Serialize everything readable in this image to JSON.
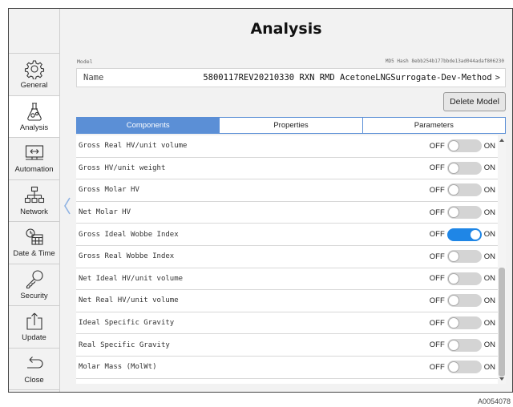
{
  "title": "Analysis",
  "sidebar": {
    "items": [
      {
        "label": "General",
        "icon": "gear-icon"
      },
      {
        "label": "Analysis",
        "icon": "flask-gears-icon",
        "active": true
      },
      {
        "label": "Automation",
        "icon": "monitor-arrows-icon"
      },
      {
        "label": "Network",
        "icon": "network-icon"
      },
      {
        "label": "Date & Time",
        "icon": "calendar-clock-icon"
      },
      {
        "label": "Security",
        "icon": "key-icon"
      },
      {
        "label": "Update",
        "icon": "upload-icon"
      },
      {
        "label": "Close",
        "icon": "return-arrow-icon"
      }
    ]
  },
  "model": {
    "label": "Model",
    "md5": "MD5 Hash 8ebb254b177bbde13ad044adaf806230",
    "name_label": "Name",
    "name_value": "5800117REV20210330 RXN RMD AcetoneLNGSurrogate-Dev-Method",
    "chevron": ">"
  },
  "delete_button": "Delete Model",
  "tabs": [
    {
      "label": "Components",
      "active": true
    },
    {
      "label": "Properties",
      "active": false
    },
    {
      "label": "Parameters",
      "active": false
    }
  ],
  "toggle_off_label": "OFF",
  "toggle_on_label": "ON",
  "rows": [
    {
      "label": "Gross Real HV/unit volume",
      "on": false
    },
    {
      "label": "Gross HV/unit weight",
      "on": false
    },
    {
      "label": "Gross Molar HV",
      "on": false
    },
    {
      "label": "Net Molar HV",
      "on": false
    },
    {
      "label": "Gross Ideal Wobbe Index",
      "on": true
    },
    {
      "label": "Gross Real Wobbe Index",
      "on": false
    },
    {
      "label": "Net Ideal HV/unit volume",
      "on": false
    },
    {
      "label": "Net Real HV/unit volume",
      "on": false
    },
    {
      "label": "Ideal Specific Gravity",
      "on": false
    },
    {
      "label": "Real Specific Gravity",
      "on": false
    },
    {
      "label": "Molar Mass (MolWt)",
      "on": false
    }
  ],
  "figure_code": "A0054078",
  "colors": {
    "accent": "#5b8fd6",
    "toggle_on": "#1f86e6",
    "toggle_off": "#d4d4d4"
  }
}
